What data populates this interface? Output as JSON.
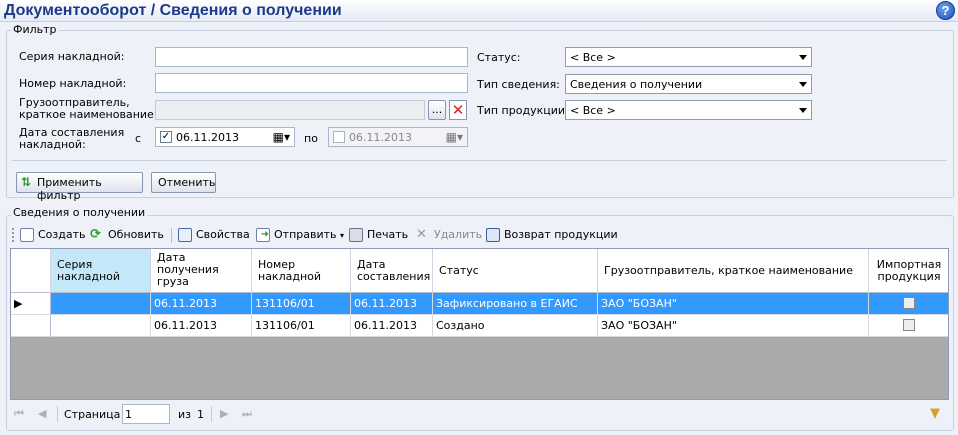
{
  "title": "Документооборот  / Сведения о получении",
  "filter": {
    "group_label": "Фильтр",
    "series_label": "Серия накладной:",
    "number_label": "Номер накладной:",
    "shipper_label_1": "Грузоотправитель,",
    "shipper_label_2": "краткое наименование:",
    "date_label_1": "Дата составления",
    "date_label_2": "накладной:",
    "from_label": "с",
    "to_label": "по",
    "date_from": "06.11.2013",
    "date_to": "06.11.2013",
    "status_label": "Статус:",
    "status_value": "< Все >",
    "info_type_label": "Тип сведения:",
    "info_type_value": "Сведения о получении",
    "product_type_label": "Тип продукции:",
    "product_type_value": "< Все >",
    "browse_label": "...",
    "apply_label": "Применить фильтр",
    "cancel_label": "Отменить"
  },
  "section": {
    "group_label": "Сведения о получении",
    "toolbar": {
      "create": "Создать",
      "refresh": "Обновить",
      "props": "Свойства",
      "send": "Отправить",
      "print": "Печать",
      "delete": "Удалить",
      "return": "Возврат продукции"
    }
  },
  "table": {
    "headers": [
      "Серия накладной",
      "Дата получения груза",
      "Номер накладной",
      "Дата составления",
      "Статус",
      "Грузоотправитель, краткое наименование",
      "Импортная продукция"
    ],
    "rows": [
      {
        "series": "",
        "received": "06.11.2013",
        "number": "131106/01",
        "date": "06.11.2013",
        "status": "Зафиксировано в ЕГАИС",
        "shipper": "ЗАО \"БОЗАН\"",
        "import": false
      },
      {
        "series": "",
        "received": "06.11.2013",
        "number": "131106/01",
        "date": "06.11.2013",
        "status": "Создано",
        "shipper": "ЗАО \"БОЗАН\"",
        "import": false
      }
    ]
  },
  "pager": {
    "page_label": "Страница",
    "page_value": "1",
    "of_label": "из",
    "total": "1"
  },
  "colors": {
    "title": "#1c3a8a",
    "selected_row": "#3399ff",
    "sorted_header": "#c5e8f8"
  }
}
